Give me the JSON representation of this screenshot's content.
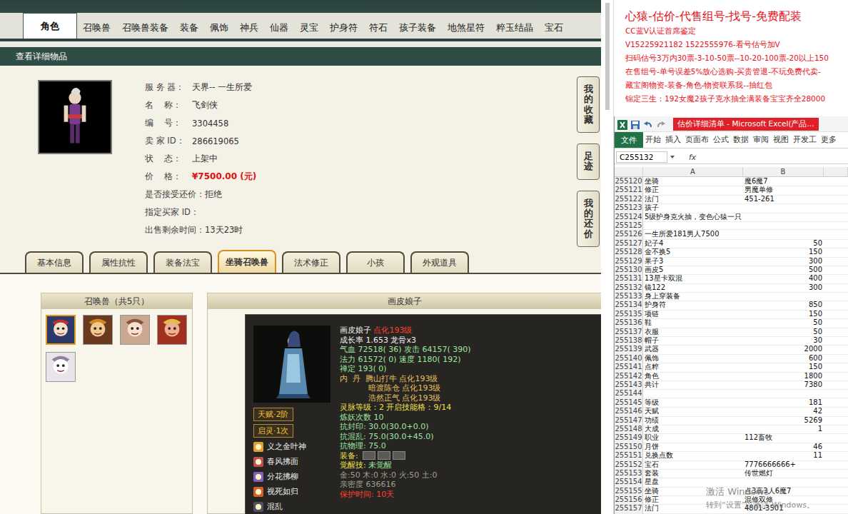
{
  "game": {
    "top_tabs": [
      {
        "label": "角色",
        "selected": true
      },
      {
        "label": "召唤兽",
        "selected": false
      },
      {
        "label": "召唤兽装备",
        "selected": false
      },
      {
        "label": "装备",
        "selected": false
      },
      {
        "label": "佩饰",
        "selected": false
      },
      {
        "label": "神兵",
        "selected": false
      },
      {
        "label": "仙器",
        "selected": false
      },
      {
        "label": "灵宝",
        "selected": false
      },
      {
        "label": "护身符",
        "selected": false
      },
      {
        "label": "符石",
        "selected": false
      },
      {
        "label": "孩子装备",
        "selected": false
      },
      {
        "label": "地煞星符",
        "selected": false
      },
      {
        "label": "粹玉结晶",
        "selected": false
      },
      {
        "label": "宝石",
        "selected": false
      }
    ],
    "detail_bar": "查看详细物品",
    "side_buttons": [
      "我的收藏",
      "足迹",
      "我的还价"
    ],
    "info": [
      {
        "label": "服 务 器：",
        "value": "天界-- 一生所爱",
        "kind": "plain"
      },
      {
        "label": "名    称：",
        "value": "飞剑侠",
        "kind": "plain"
      },
      {
        "label": "编    号：",
        "value": "3304458",
        "kind": "plain"
      },
      {
        "label": "卖 家 ID：",
        "value": "286619065",
        "kind": "plain"
      },
      {
        "label": "状    态：",
        "value": "上架中",
        "kind": "plain"
      },
      {
        "label": "价    格：",
        "value": "¥7500.00 (元)",
        "kind": "price"
      },
      {
        "label": "是否接受还价：",
        "value": "拒绝",
        "kind": "plain"
      },
      {
        "label": "指定买家 ID：",
        "value": "",
        "kind": "plain"
      },
      {
        "label": "出售剩余时间：",
        "value": "13天23时",
        "kind": "plain"
      }
    ],
    "sub_tabs": [
      {
        "label": "基本信息",
        "selected": false
      },
      {
        "label": "属性抗性",
        "selected": false
      },
      {
        "label": "装备法宝",
        "selected": false
      },
      {
        "label": "坐骑召唤兽",
        "selected": true
      },
      {
        "label": "法术修正",
        "selected": false
      },
      {
        "label": "小孩",
        "selected": false
      },
      {
        "label": "外观道具",
        "selected": false
      }
    ],
    "pets_panel": {
      "title": "召唤兽（共5只）",
      "pets": [
        {
          "selected": true
        },
        {
          "selected": false
        },
        {
          "selected": false
        },
        {
          "selected": false
        },
        {
          "selected": false
        }
      ]
    },
    "detail_panel_title": "画皮娘子",
    "tooltip": {
      "talent": "天赋·2阶",
      "qiling": "启灵·1次",
      "skills": [
        "义之金叶神",
        "春风拂面",
        "分花拂柳",
        "视死如归",
        "混乱"
      ],
      "lines": [
        {
          "kind": "text",
          "segs": [
            {
              "text": "画皮娘子",
              "tone": "white"
            },
            {
              "text": " 点化193级",
              "tone": "red"
            }
          ]
        },
        {
          "kind": "text",
          "segs": [
            {
              "text": "成长率 1.653 龙骨x3",
              "tone": "white"
            }
          ]
        },
        {
          "kind": "text",
          "segs": [
            {
              "text": "气血 72518( 36) 攻击 64157( 390)",
              "tone": "green"
            }
          ]
        },
        {
          "kind": "text",
          "segs": [
            {
              "text": "法力 61572( 0) 速度 1180( 192)",
              "tone": "green"
            }
          ]
        },
        {
          "kind": "text",
          "segs": [
            {
              "text": "禅定 193( 0)",
              "tone": "green"
            }
          ]
        },
        {
          "kind": "text",
          "segs": [
            {
              "text": "内  丹  ",
              "tone": "gold"
            },
            {
              "text": "腾山打牛 点化193级",
              "tone": "gold"
            }
          ]
        },
        {
          "kind": "indent",
          "segs": [
            {
              "text": "暗渡陈仓 点化193级",
              "tone": "gold"
            }
          ]
        },
        {
          "kind": "indent",
          "segs": [
            {
              "text": "浩然正气 点化193级",
              "tone": "gold"
            }
          ]
        },
        {
          "kind": "text",
          "segs": [
            {
              "text": "灵脉等级：2 开启技能格：9/14",
              "tone": "yellow"
            }
          ]
        },
        {
          "kind": "text",
          "segs": [
            {
              "text": "炼妖次数 10",
              "tone": "green"
            }
          ]
        },
        {
          "kind": "text",
          "segs": [
            {
              "text": "抗封印: 30.0(30.0+0.0)",
              "tone": "green"
            }
          ]
        },
        {
          "kind": "text",
          "segs": [
            {
              "text": "抗混乱: 75.0(30.0+45.0)",
              "tone": "green"
            }
          ]
        },
        {
          "kind": "text",
          "segs": [
            {
              "text": "抗物理: 75.0",
              "tone": "green"
            }
          ]
        },
        {
          "kind": "equip",
          "slots": 3,
          "segs": [
            {
              "text": "装备:",
              "tone": "yellow"
            }
          ]
        },
        {
          "kind": "text",
          "segs": [
            {
              "text": "觉醒技: ",
              "tone": "yellow"
            },
            {
              "text": "未觉醒",
              "tone": "green"
            }
          ]
        },
        {
          "kind": "text",
          "segs": [
            {
              "text": "金:50 木:0 水:0 火:50 土:0",
              "tone": "gray"
            }
          ]
        },
        {
          "kind": "text",
          "segs": [
            {
              "text": "亲密度 636616",
              "tone": "gray"
            }
          ]
        },
        {
          "kind": "text",
          "segs": [
            {
              "text": "保护时间: 10天",
              "tone": "red"
            }
          ]
        }
      ]
    }
  },
  "ad": {
    "headline": "心猿-估价-代售组号-找号-免费配装",
    "lines": [
      "CC蓝V认证首席鉴定",
      "V15225921182 1522555976-看号估号加V",
      "扫码估号3万内30票-3-10-50票--10-20-100票-20以上150",
      "在售组号-单号误差5%放心选购-买贵管退-不玩免费代卖-",
      "藏宝阁物资-装备-角色-物资联系我--抽红包",
      "锦定三生：192女魔2孩子克水抽全满装备宝宝齐全28000"
    ]
  },
  "excel": {
    "title": "估价详细清单 - Microsoft Excel(产品...",
    "file_tab": "文件",
    "tabs": [
      "开始",
      "插入",
      "页面布",
      "公式",
      "数据",
      "审阅",
      "视图",
      "开发工",
      "更多"
    ],
    "name_box": "C255132",
    "fx": "fx",
    "columns": [
      "A",
      "B"
    ],
    "rows": [
      {
        "n": "255120",
        "a": "坐骑",
        "b": "魔6魔7",
        "kind": "text"
      },
      {
        "n": "255121",
        "a": "修正",
        "b": "男魔单修",
        "kind": "text"
      },
      {
        "n": "255122",
        "a": "法门",
        "b": "451-261",
        "kind": "text"
      },
      {
        "n": "255123",
        "a": "孩子",
        "b": "",
        "kind": "text"
      },
      {
        "n": "255124",
        "a": "5级护身克火抽，变色心猿一只",
        "b": "",
        "kind": "text"
      },
      {
        "n": "255125",
        "a": "",
        "b": "",
        "kind": "text"
      },
      {
        "n": "255126",
        "a": "一生所爱181男人7500",
        "b": "",
        "kind": "text"
      },
      {
        "n": "255127",
        "a": "妃子4",
        "b": "50",
        "kind": "number"
      },
      {
        "n": "255128",
        "a": "金不换5",
        "b": "150",
        "kind": "number"
      },
      {
        "n": "255129",
        "a": "果子3",
        "b": "300",
        "kind": "number"
      },
      {
        "n": "255130",
        "a": "画皮5",
        "b": "500",
        "kind": "number"
      },
      {
        "n": "255131",
        "a": "13星卡双混",
        "b": "400",
        "kind": "number"
      },
      {
        "n": "255132",
        "a": "镜122",
        "b": "300",
        "kind": "number"
      },
      {
        "n": "255133",
        "a": "身上穿装备",
        "b": "",
        "kind": "text"
      },
      {
        "n": "255134",
        "a": "护身符",
        "b": "850",
        "kind": "number"
      },
      {
        "n": "255135",
        "a": "项链",
        "b": "150",
        "kind": "number"
      },
      {
        "n": "255136",
        "a": "鞋",
        "b": "50",
        "kind": "number"
      },
      {
        "n": "255137",
        "a": "衣服",
        "b": "50",
        "kind": "number"
      },
      {
        "n": "255138",
        "a": "帽子",
        "b": "30",
        "kind": "number"
      },
      {
        "n": "255139",
        "a": "武器",
        "b": "2000",
        "kind": "number"
      },
      {
        "n": "255140",
        "a": "佩饰",
        "b": "600",
        "kind": "number"
      },
      {
        "n": "255141",
        "a": "点粹",
        "b": "150",
        "kind": "number"
      },
      {
        "n": "255142",
        "a": "角色",
        "b": "1800",
        "kind": "number"
      },
      {
        "n": "255143",
        "a": "共计",
        "b": "7380",
        "kind": "number"
      },
      {
        "n": "255144",
        "a": "",
        "b": "",
        "kind": "text"
      },
      {
        "n": "255145",
        "a": "等级",
        "b": "181",
        "kind": "number"
      },
      {
        "n": "255146",
        "a": "天赋",
        "b": "42",
        "kind": "number"
      },
      {
        "n": "255147",
        "a": "功绩",
        "b": "5269",
        "kind": "number"
      },
      {
        "n": "255148",
        "a": "大成",
        "b": "1",
        "kind": "number"
      },
      {
        "n": "255149",
        "a": "职业",
        "b": "112畜牧",
        "kind": "text"
      },
      {
        "n": "255150",
        "a": "月饼",
        "b": "46",
        "kind": "number"
      },
      {
        "n": "255151",
        "a": "兑换点数",
        "b": "11",
        "kind": "number"
      },
      {
        "n": "255152",
        "a": "宝石",
        "b": "7776666666+",
        "kind": "text"
      },
      {
        "n": "255153",
        "a": "套装",
        "b": "传世燃灯",
        "kind": "text"
      },
      {
        "n": "255154",
        "a": "星盘",
        "b": "",
        "kind": "text"
      },
      {
        "n": "255155",
        "a": "坐骑",
        "b": "点3高3人6魔7",
        "kind": "text"
      },
      {
        "n": "255156",
        "a": "修正",
        "b": "混修双修",
        "kind": "text"
      },
      {
        "n": "255157",
        "a": "法门",
        "b": "4801-3501",
        "kind": "text"
      }
    ]
  },
  "watermark": {
    "line1": "激活 Windows",
    "line2": "转到“设置”以激活 Windows。"
  }
}
